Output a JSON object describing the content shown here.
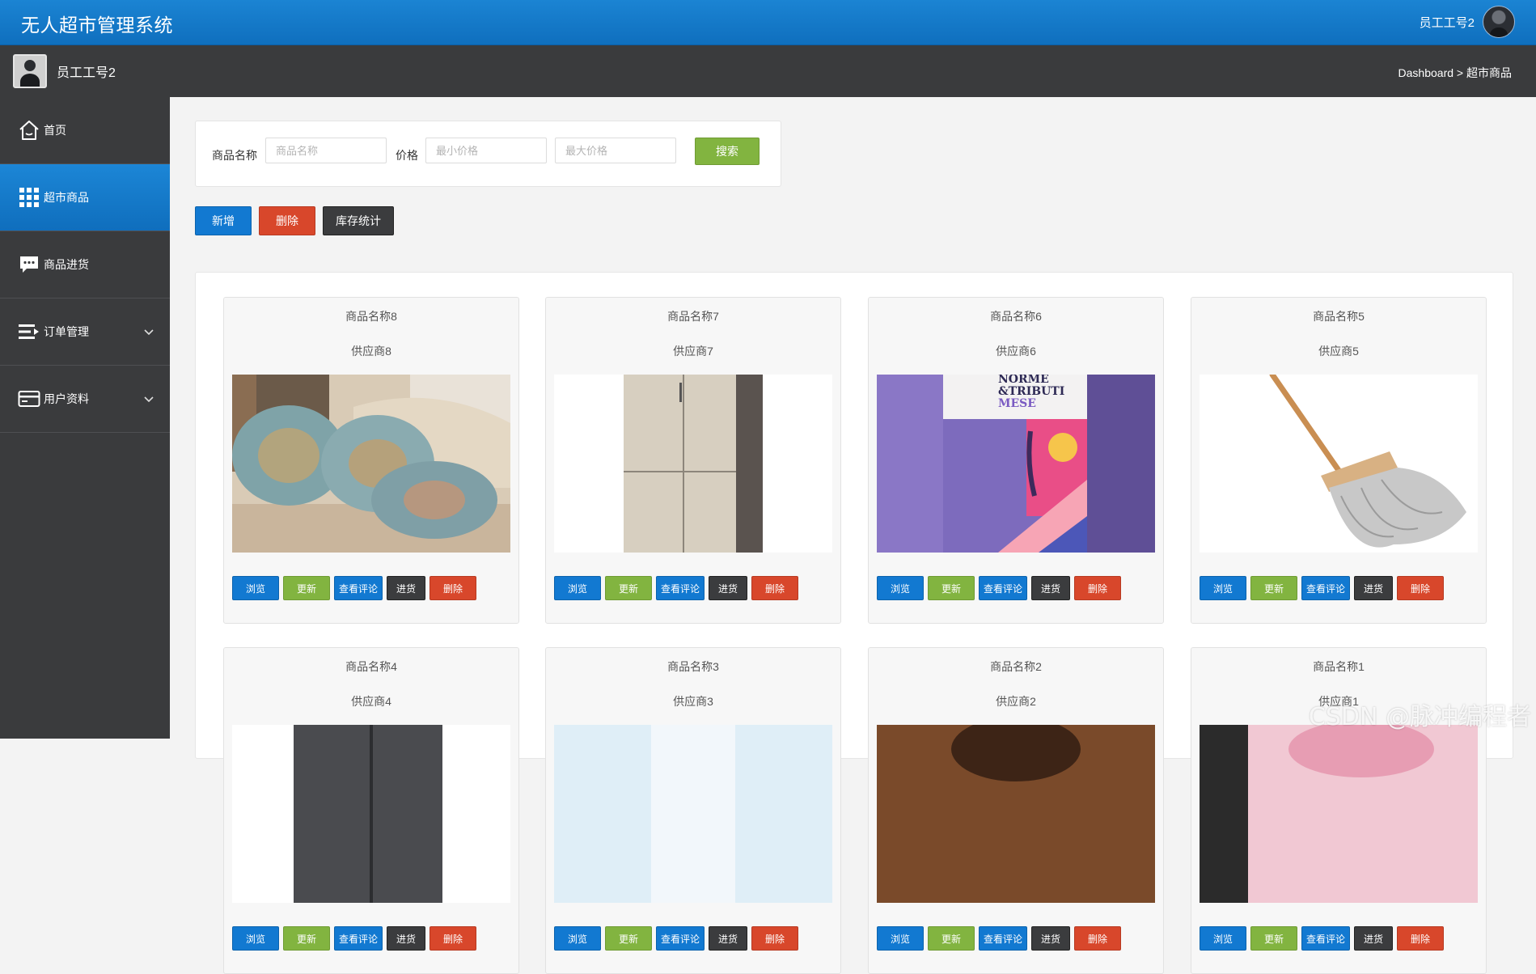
{
  "app": {
    "title": "无人超市管理系统"
  },
  "top_user": {
    "name": "员工工号2"
  },
  "sub_user": {
    "name": "员工工号2"
  },
  "breadcrumb": {
    "root": "Dashboard",
    "separator": ">",
    "current": "超市商品"
  },
  "sidebar": {
    "items": [
      {
        "label": "首页",
        "icon": "home-icon",
        "active": false,
        "expandable": false
      },
      {
        "label": "超市商品",
        "icon": "grid-icon",
        "active": true,
        "expandable": false
      },
      {
        "label": "商品进货",
        "icon": "chat-icon",
        "active": false,
        "expandable": false
      },
      {
        "label": "订单管理",
        "icon": "list-icon",
        "active": false,
        "expandable": true
      },
      {
        "label": "用户资料",
        "icon": "card-icon",
        "active": false,
        "expandable": true
      }
    ]
  },
  "search": {
    "name_label": "商品名称",
    "name_placeholder": "商品名称",
    "name_value": "",
    "price_label": "价格",
    "min_placeholder": "最小价格",
    "min_value": "",
    "max_placeholder": "最大价格",
    "max_value": "",
    "button": "搜索"
  },
  "actions": {
    "add": "新增",
    "delete": "删除",
    "stock": "库存统计"
  },
  "card_buttons": {
    "view": "浏览",
    "update": "更新",
    "reviews": "查看评论",
    "restock": "进货",
    "delete": "删除"
  },
  "products": [
    {
      "name": "商品名称8",
      "supplier": "供应商8",
      "image": "cushions"
    },
    {
      "name": "商品名称7",
      "supplier": "供应商7",
      "image": "refrigerator"
    },
    {
      "name": "商品名称6",
      "supplier": "供应商6",
      "image": "magazine"
    },
    {
      "name": "商品名称5",
      "supplier": "供应商5",
      "image": "mop"
    },
    {
      "name": "商品名称4",
      "supplier": "供应商4",
      "image": "dark"
    },
    {
      "name": "商品名称3",
      "supplier": "供应商3",
      "image": "light"
    },
    {
      "name": "商品名称2",
      "supplier": "供应商2",
      "image": "brown"
    },
    {
      "name": "商品名称1",
      "supplier": "供应商1",
      "image": "pink"
    }
  ],
  "magazine_text": {
    "line1": "NORME",
    "line2": "&TRIBUTI",
    "line3": "MESE"
  },
  "watermark": "CSDN @脉冲编程者",
  "colors": {
    "primary": "#1279d1",
    "success": "#82b440",
    "danger": "#d8472b",
    "dark": "#3b3c3e",
    "sidebar": "#3a3b3d"
  }
}
